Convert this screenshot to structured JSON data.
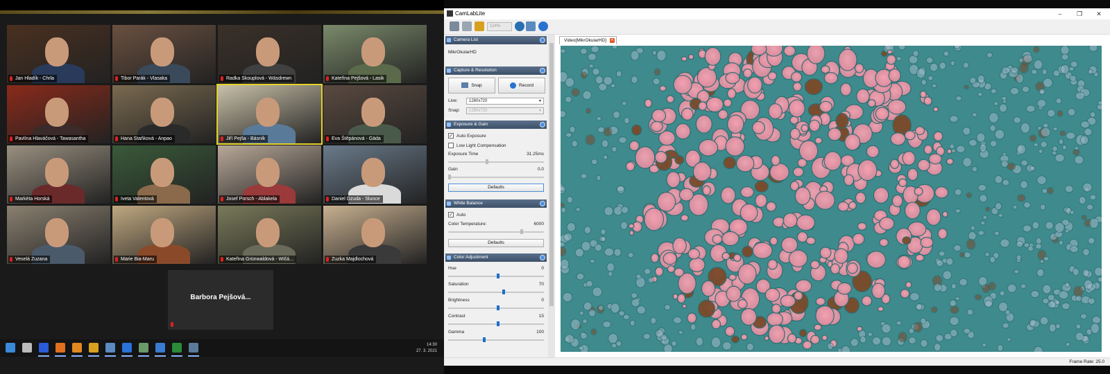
{
  "zoom": {
    "participants": [
      {
        "name": "Jan Hladík - Chrla",
        "active": false
      },
      {
        "name": "Tibor Parák - Vlasaka",
        "active": false
      },
      {
        "name": "Radka Skouplová - Wásdrewn",
        "active": false
      },
      {
        "name": "Kateřina Pejšová - Lasik",
        "active": false
      },
      {
        "name": "Pavlína Hlaváčová - Tawasantha",
        "active": false
      },
      {
        "name": "Hana Staňková - Anpao",
        "active": false
      },
      {
        "name": "Jiří Pejša - Básník",
        "active": true
      },
      {
        "name": "Eva Štěpánová - Gäda",
        "active": false
      },
      {
        "name": "Markéta Horská",
        "active": false
      },
      {
        "name": "Iveta Valentová",
        "active": false
      },
      {
        "name": "Josef Porsch - Ablakela",
        "active": false
      },
      {
        "name": "Daniel Dzuda - Slunce",
        "active": false
      },
      {
        "name": "Veselá Zuzana",
        "active": false
      },
      {
        "name": "Marie Bia-Maru",
        "active": false
      },
      {
        "name": "Kateřina Grünwaldová - Wičá...",
        "active": false
      },
      {
        "name": "Zuzka Majdlochová",
        "active": false
      }
    ],
    "self_name": "Barbora  Pejšová...",
    "clock": {
      "time": "14:30",
      "date": "27. 3. 2021"
    }
  },
  "taskbar": {
    "icons": [
      "windows-start-icon",
      "search-icon",
      "file-explorer-icon",
      "firefox-icon",
      "vlc-icon",
      "winamp-icon",
      "notes-icon",
      "zoom-icon",
      "chrome-icon",
      "photos-icon",
      "excel-icon",
      "camera-icon"
    ]
  },
  "camlab": {
    "title": "CamLabLite",
    "zoom_level": "124%",
    "tab_label": "Video[MikrOkularHD]",
    "sections": {
      "camera_list": {
        "title": "Camera List",
        "camera": "MikrOkularHD"
      },
      "capture": {
        "title": "Capture & Resolution",
        "snap_label": "Snap",
        "record_label": "Record",
        "live_label": "Live:",
        "live_value": "1280x720",
        "snap_res_label": "Snap:",
        "snap_res_value": "1280x720"
      },
      "exposure": {
        "title": "Exposure & Gain",
        "auto_exposure": "Auto Exposure",
        "auto_exposure_checked": true,
        "low_light": "Low Light Compensation",
        "low_light_checked": false,
        "exposure_time_label": "Exposure Time",
        "exposure_time_value": "31.25ms",
        "gain_label": "Gain",
        "gain_value": "0.0",
        "defaults_label": "Defaults"
      },
      "white_balance": {
        "title": "White Balance",
        "auto_label": "Auto",
        "auto_checked": true,
        "color_temp_label": "Color Temperature:",
        "color_temp_value": "6000",
        "defaults_label": "Defaults"
      },
      "color_adjust": {
        "title": "Color Adjustment",
        "rows": [
          {
            "label": "Hue",
            "value": "0"
          },
          {
            "label": "Saturation",
            "value": "70"
          },
          {
            "label": "Brightness",
            "value": "0"
          },
          {
            "label": "Contrast",
            "value": "15"
          },
          {
            "label": "Gamma",
            "value": "100"
          }
        ]
      }
    },
    "frame_rate": "Frame Rate: 25.0"
  }
}
